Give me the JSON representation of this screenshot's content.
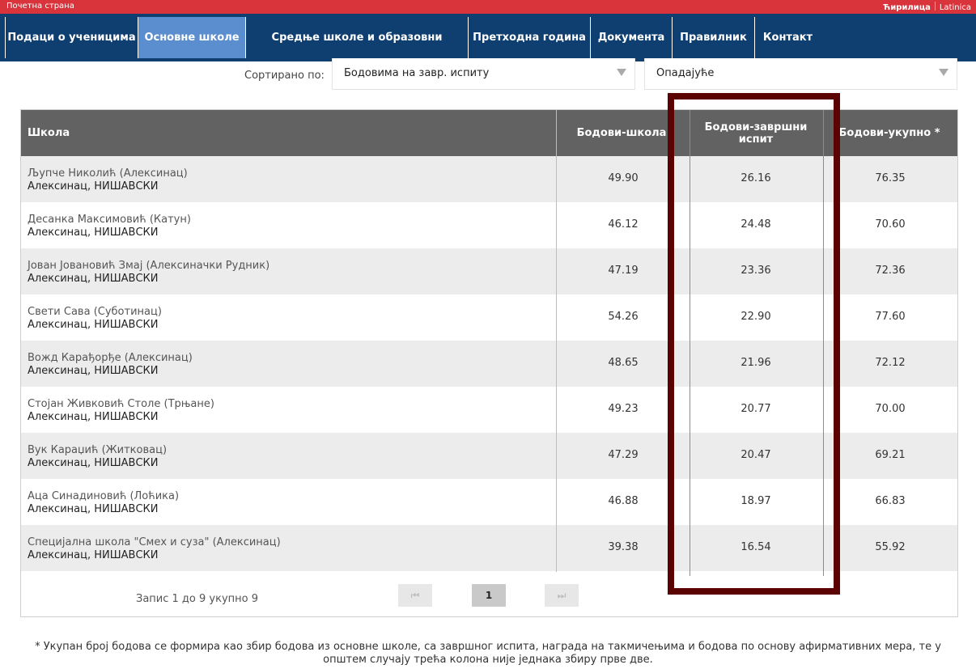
{
  "topbar": {
    "home": "Почетна страна",
    "lang_cyrillic": "Ћирилица",
    "lang_latin": "Latinica"
  },
  "nav": [
    {
      "label": "Подаци о ученицима"
    },
    {
      "label": "Основне школе"
    },
    {
      "label": "Средње школе и образовни профили"
    },
    {
      "label": "Претходна година"
    },
    {
      "label": "Документа"
    },
    {
      "label": "Правилник"
    },
    {
      "label": "Контакт"
    }
  ],
  "sort": {
    "label": "Сортирано по:",
    "field": "Бодовима на завр. испиту",
    "order": "Опадајуће"
  },
  "table": {
    "headers": {
      "school": "Школа",
      "points_school": "Бодови-школа",
      "points_exam_1": "Бодови-завршни",
      "points_exam_2": "испит",
      "points_total": "Бодови-укупно *"
    },
    "rows": [
      {
        "school": "Љупче Николић (Алексинац)",
        "place": "Алексинац, НИШАВСКИ",
        "school_pts": "49.90",
        "exam_pts": "26.16",
        "total": "76.35"
      },
      {
        "school": "Десанка Максимовић (Катун)",
        "place": "Алексинац, НИШАВСКИ",
        "school_pts": "46.12",
        "exam_pts": "24.48",
        "total": "70.60"
      },
      {
        "school": "Јован Јовановић Змај (Алексиначки Рудник)",
        "place": "Алексинац, НИШАВСКИ",
        "school_pts": "47.19",
        "exam_pts": "23.36",
        "total": "72.36"
      },
      {
        "school": "Свети Сава (Суботинац)",
        "place": "Алексинац, НИШАВСКИ",
        "school_pts": "54.26",
        "exam_pts": "22.90",
        "total": "77.60"
      },
      {
        "school": "Вожд Карађорђе (Алексинац)",
        "place": "Алексинац, НИШАВСКИ",
        "school_pts": "48.65",
        "exam_pts": "21.96",
        "total": "72.12"
      },
      {
        "school": "Стојан Живковић Столе (Трњане)",
        "place": "Алексинац, НИШАВСКИ",
        "school_pts": "49.23",
        "exam_pts": "20.77",
        "total": "70.00"
      },
      {
        "school": "Вук Караџић (Житковац)",
        "place": "Алексинац, НИШАВСКИ",
        "school_pts": "47.29",
        "exam_pts": "20.47",
        "total": "69.21"
      },
      {
        "school": "Аца Синадиновић (Лоћика)",
        "place": "Алексинац, НИШАВСКИ",
        "school_pts": "46.88",
        "exam_pts": "18.97",
        "total": "66.83"
      },
      {
        "school": "Специјална школа \"Смех и суза\" (Алексинац)",
        "place": "Алексинац, НИШАВСКИ",
        "school_pts": "39.38",
        "exam_pts": "16.54",
        "total": "55.92"
      }
    ]
  },
  "pagination": {
    "info": "Запис 1 до 9 укупно 9",
    "current": "1",
    "prev_icon": "⏮",
    "next_icon": "⏭"
  },
  "note": "* Укупан број бодова се формира као збир бодова из основне школе, са завршног испита, награда на такмичењима и бодова по основу афирмативних мера, те у општем случају трећа колона није једнака збиру прве две."
}
